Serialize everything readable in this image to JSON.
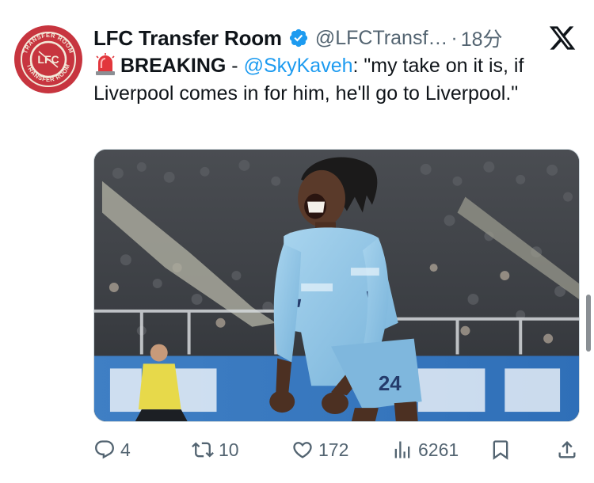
{
  "tweet": {
    "avatar": {
      "ring_text_top": "TRANSFER ROOM",
      "ring_text_bottom": "TRANSFER ROOM",
      "center_text": "LFC",
      "bg_color": "#c7353f"
    },
    "display_name": "LFC Transfer Room",
    "handle": "@LFCTransf…",
    "separator": "·",
    "time": "18分",
    "verified_color": "#1d9bf0",
    "body": {
      "label": "BREAKING",
      "dash": " - ",
      "mention": "@SkyKaveh",
      "quote": ": \"my take on it is, if Liverpool comes in for him, he'll go to Liverpool.\""
    },
    "media": {
      "shirt_number": "24"
    },
    "actions": {
      "replies": "4",
      "retweets": "10",
      "likes": "172",
      "views": "6261"
    }
  }
}
